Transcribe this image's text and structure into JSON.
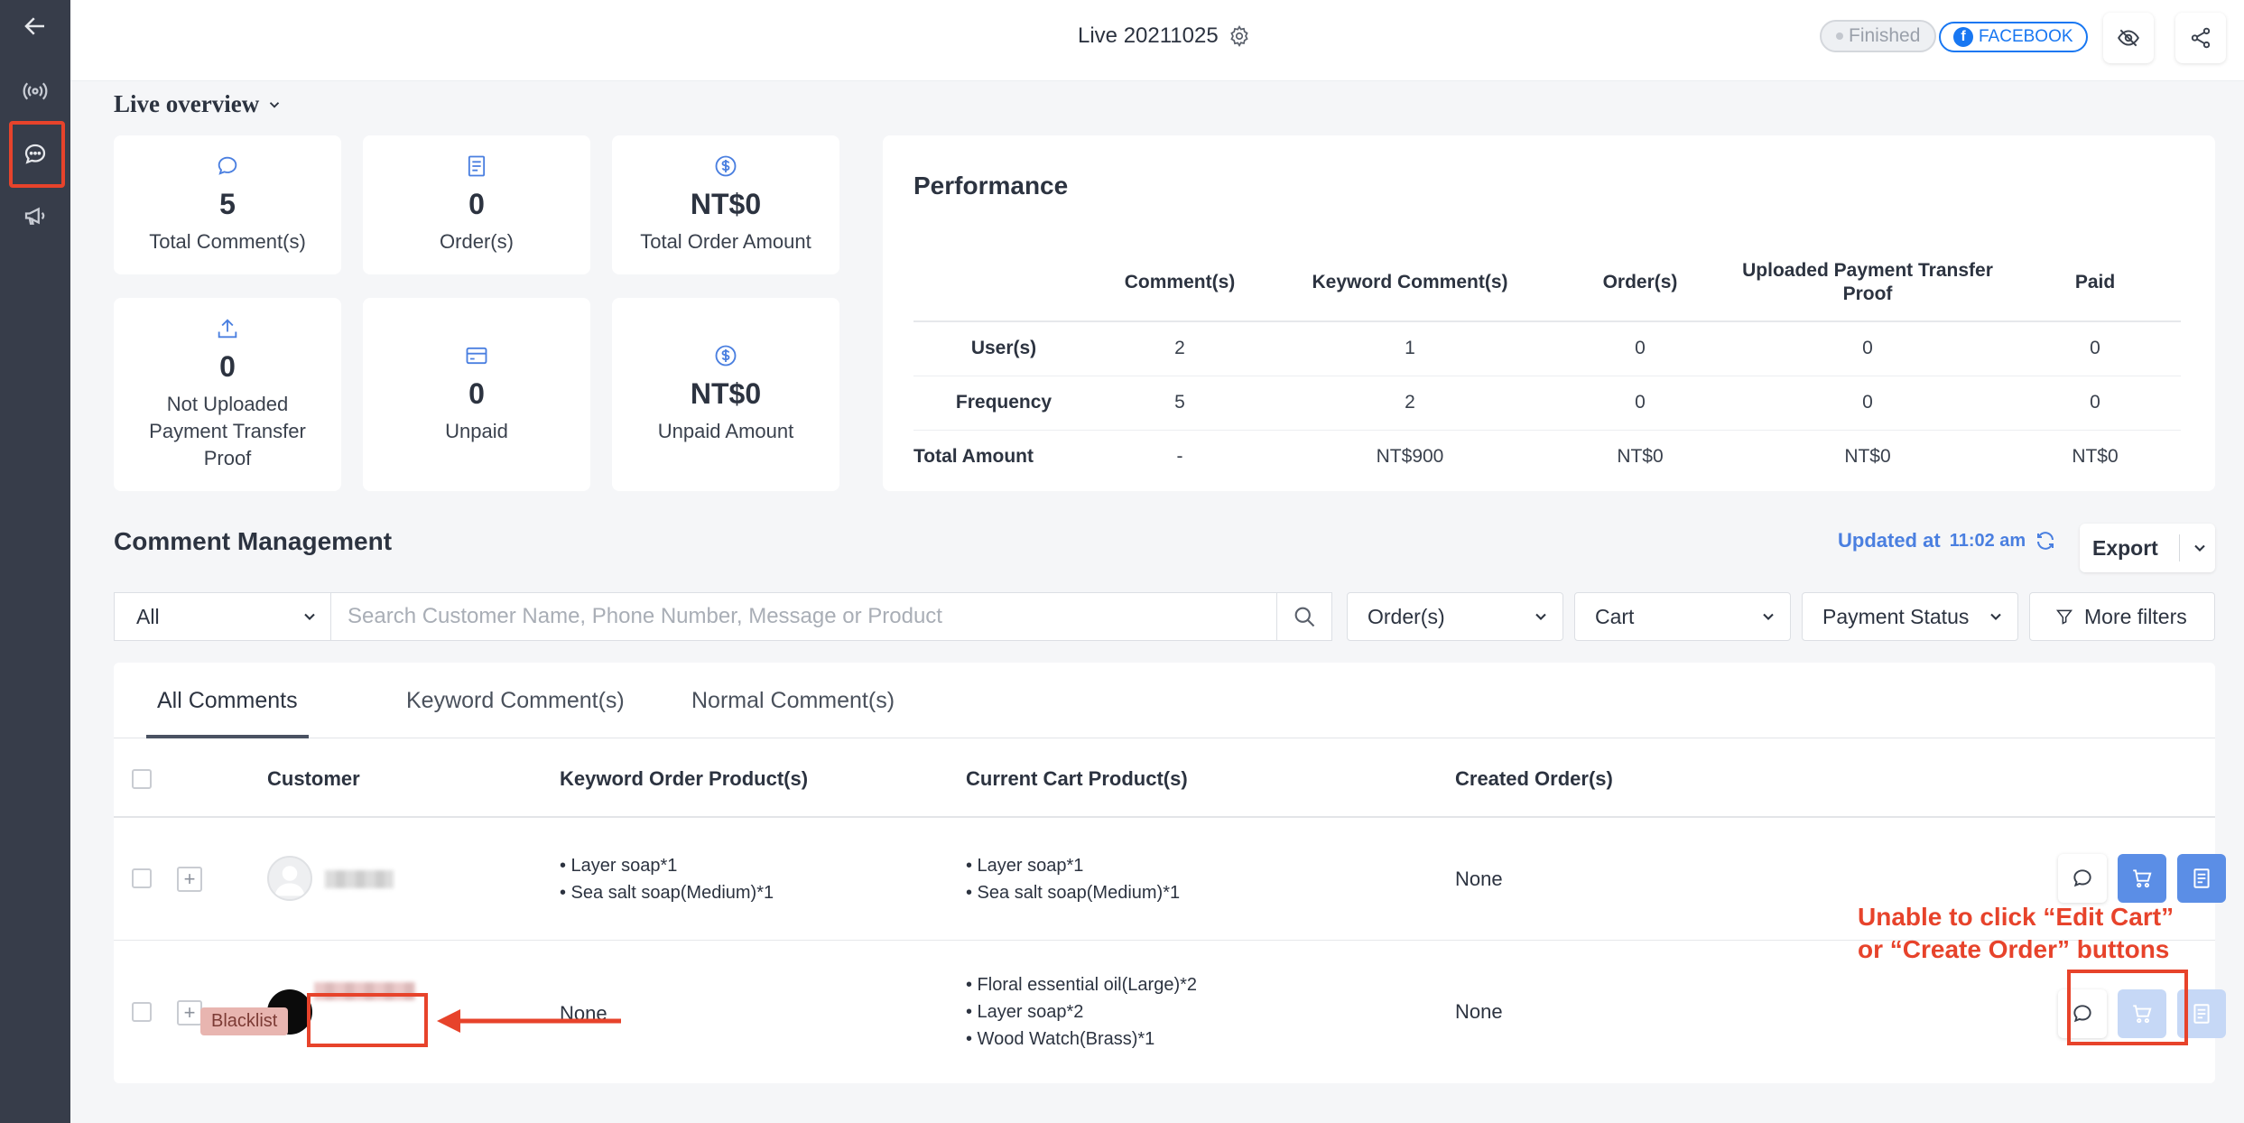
{
  "header": {
    "title": "Live 20211025",
    "status": "Finished",
    "platform": "FACEBOOK",
    "platform_icon": "f"
  },
  "overview": {
    "title": "Live overview",
    "cards": [
      {
        "value": "5",
        "label": "Total Comment(s)",
        "icon": "comment-icon"
      },
      {
        "value": "0",
        "label": "Order(s)",
        "icon": "order-icon"
      },
      {
        "value": "NT$0",
        "label": "Total Order Amount",
        "icon": "dollar-icon"
      },
      {
        "value": "0",
        "label": "Not Uploaded Payment Transfer Proof",
        "icon": "upload-icon"
      },
      {
        "value": "0",
        "label": "Unpaid",
        "icon": "card-icon"
      },
      {
        "value": "NT$0",
        "label": "Unpaid Amount",
        "icon": "dollar-icon"
      }
    ]
  },
  "performance": {
    "title": "Performance",
    "columns": [
      "Comment(s)",
      "Keyword Comment(s)",
      "Order(s)",
      "Uploaded Payment Transfer Proof",
      "Paid"
    ],
    "rows": [
      {
        "label": "User(s)",
        "values": [
          "2",
          "1",
          "0",
          "0",
          "0"
        ]
      },
      {
        "label": "Frequency",
        "values": [
          "5",
          "2",
          "0",
          "0",
          "0"
        ]
      },
      {
        "label": "Total Amount",
        "values": [
          "-",
          "NT$900",
          "NT$0",
          "NT$0",
          "NT$0"
        ]
      }
    ]
  },
  "comment_management": {
    "title": "Comment Management",
    "updated_label": "Updated at",
    "updated_time": "11:02 am",
    "export_label": "Export",
    "filters": {
      "scope": "All",
      "search_placeholder": "Search Customer Name, Phone Number, Message or Product",
      "orders": "Order(s)",
      "cart": "Cart",
      "payment_status": "Payment Status",
      "more_filters": "More filters"
    },
    "tabs": [
      "All Comments",
      "Keyword Comment(s)",
      "Normal Comment(s)"
    ],
    "columns": [
      "Customer",
      "Keyword Order Product(s)",
      "Current Cart Product(s)",
      "Created Order(s)"
    ],
    "rows": [
      {
        "keyword_products": [
          "• Layer soap*1",
          "• Sea salt soap(Medium)*1"
        ],
        "cart_products": [
          "• Layer soap*1",
          "• Sea salt soap(Medium)*1"
        ],
        "created_orders": "None"
      },
      {
        "tag": "Blacklist",
        "keyword_products_text": "None",
        "cart_products": [
          "• Floral essential oil(Large)*2",
          "• Layer soap*2",
          "• Wood Watch(Brass)*1"
        ],
        "created_orders": "None"
      }
    ]
  },
  "annotation": {
    "line1": "Unable to click “Edit Cart”",
    "line2": "or “Create Order” buttons",
    "color": "#e7432b"
  },
  "colors": {
    "sidebar": "#373d4a",
    "accent": "#5b8ee6",
    "accent_disabled": "#c6d8f6",
    "facebook": "#1877f2"
  }
}
